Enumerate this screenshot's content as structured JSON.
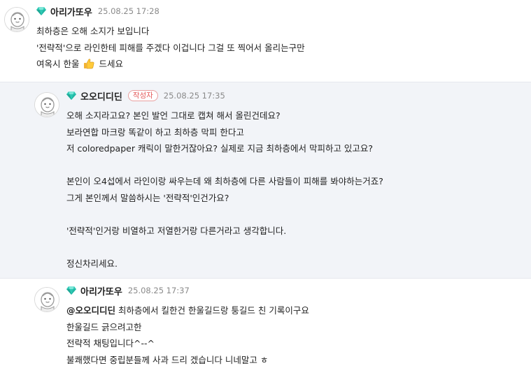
{
  "comments": [
    {
      "nick": "아리가또우",
      "date": "25.08.25 17:28",
      "lines": [
        "최하층은 오해 소지가 보입니다",
        "'전략적'으로 라인한테 피해를 주겠다 이겁니다 그걸 또 찍어서 올리는구만"
      ],
      "last_line_before": "여옥시 한울",
      "last_line_after": "드세요",
      "emoji": "thumbs-up-icon"
    },
    {
      "nick": "오오디디딘",
      "badge": "작성자",
      "date": "25.08.25 17:35",
      "lines": [
        "오해 소지라고요? 본인 발언 그대로 캡쳐 해서 올린건데요?",
        "보라연합 마크랑 똑같이 하고 최하층 막피 한다고",
        "저 coloredpaper 캐릭이 말한거잖아요? 실제로 지금 최하층에서 막피하고 있고요?",
        "",
        "본인이 오4섭에서 라인이랑 싸우는데 왜 최하층에 다른 사람들이 피해를 봐야하는거죠?",
        "그게 본인께서 말씀하시는 '전략적'인건가요?",
        "",
        "'전략적'인거랑 비열하고 저열한거랑 다른거라고 생각합니다.",
        "",
        "정신차리세요."
      ]
    },
    {
      "nick": "아리가또우",
      "date": "25.08.25 17:37",
      "mention": "@오오디디딘",
      "first_line": "최하층에서 킬한건 한울길드랑 퉁길드 친 기록이구요",
      "lines": [
        "한울길드 긁으려고한",
        "전략적 채팅입니다^--^",
        "불쾌했다면 중립분들께 사과 드리 겠습니다 니네말고 ㅎ"
      ]
    }
  ],
  "colors": {
    "author_badge": "#e45a5a",
    "gem": "#2fc8b4",
    "highlight_bg": "#f2f4f8"
  }
}
